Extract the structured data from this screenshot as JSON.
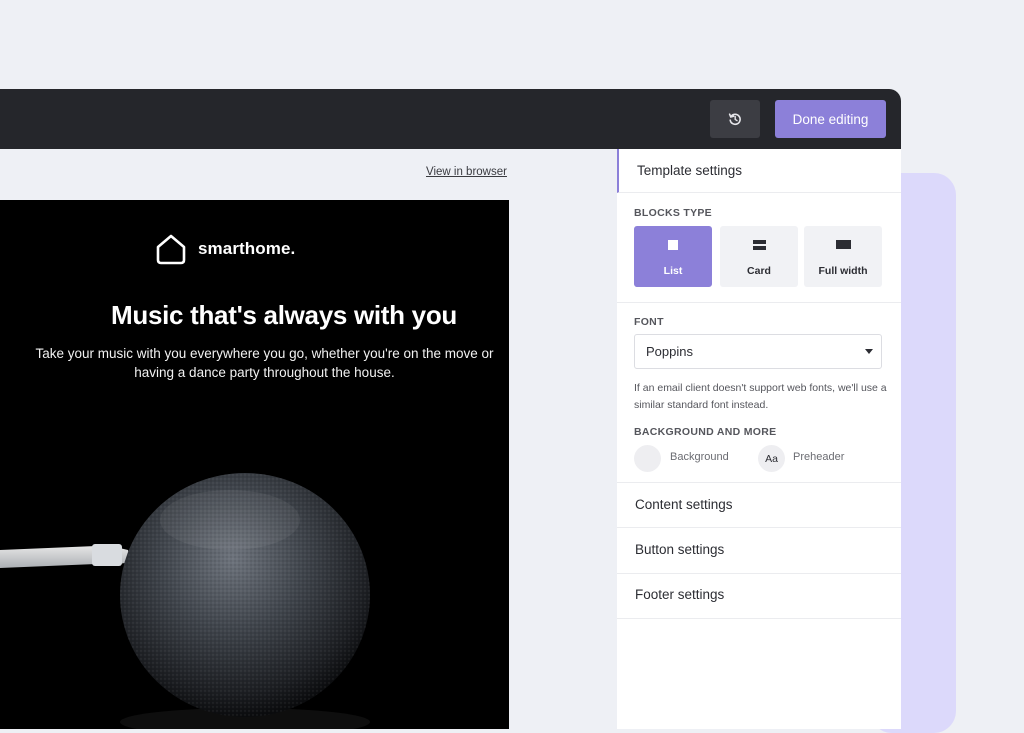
{
  "toolbar": {
    "history_icon": "history-icon",
    "done_label": "Done editing",
    "accent": "#8c80d9",
    "bar_color": "#25262b"
  },
  "canvas": {
    "view_in_browser": "View in browser"
  },
  "email": {
    "brand_icon": "house-icon",
    "brand_name": "smarthome.",
    "headline": "Music that's always with you",
    "subcopy_line1": "Take your music with you everywhere you go, whether you're on the move or",
    "subcopy_line2": "having a dance party throughout the house.",
    "image": "smart-speaker-photo"
  },
  "panel": {
    "template_settings": "Template settings",
    "blocks_type_label": "BLOCKS TYPE",
    "blocks": [
      {
        "label": "List",
        "icon": "square-icon",
        "active": true
      },
      {
        "label": "Card",
        "icon": "card-icon",
        "active": false
      },
      {
        "label": "Full width",
        "icon": "full-width-icon",
        "active": false
      }
    ],
    "font_label": "FONT",
    "font_value": "Poppins",
    "font_note": "If an email client doesn't support web fonts, we'll use a similar standard font instead.",
    "bg_more_label": "BACKGROUND AND MORE",
    "background_label": "Background",
    "preheader_glyph": "Aa",
    "preheader_label": "Preheader",
    "content_settings": "Content settings",
    "button_settings": "Button settings",
    "footer_settings": "Footer settings"
  }
}
